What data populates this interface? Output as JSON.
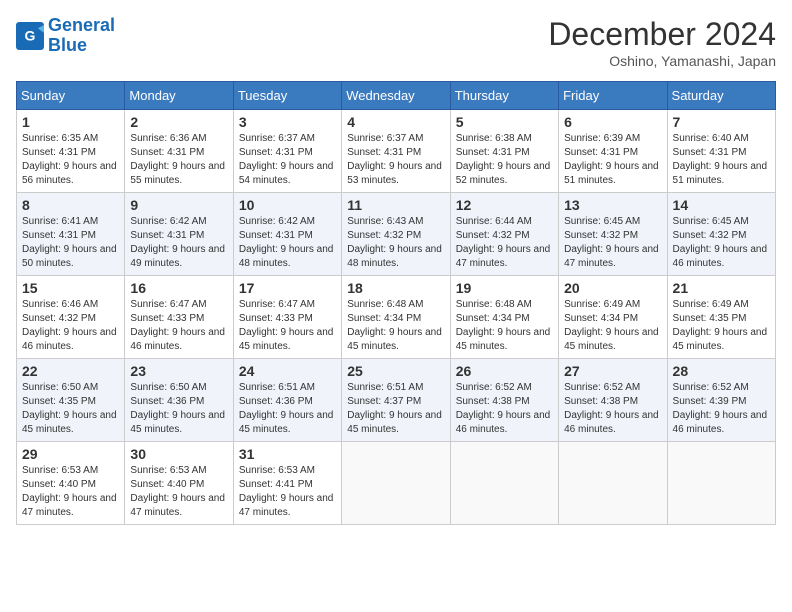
{
  "logo": {
    "line1": "General",
    "line2": "Blue"
  },
  "title": "December 2024",
  "location": "Oshino, Yamanashi, Japan",
  "weekdays": [
    "Sunday",
    "Monday",
    "Tuesday",
    "Wednesday",
    "Thursday",
    "Friday",
    "Saturday"
  ],
  "weeks": [
    [
      {
        "day": "1",
        "sunrise": "6:35 AM",
        "sunset": "4:31 PM",
        "daylight": "9 hours and 56 minutes."
      },
      {
        "day": "2",
        "sunrise": "6:36 AM",
        "sunset": "4:31 PM",
        "daylight": "9 hours and 55 minutes."
      },
      {
        "day": "3",
        "sunrise": "6:37 AM",
        "sunset": "4:31 PM",
        "daylight": "9 hours and 54 minutes."
      },
      {
        "day": "4",
        "sunrise": "6:37 AM",
        "sunset": "4:31 PM",
        "daylight": "9 hours and 53 minutes."
      },
      {
        "day": "5",
        "sunrise": "6:38 AM",
        "sunset": "4:31 PM",
        "daylight": "9 hours and 52 minutes."
      },
      {
        "day": "6",
        "sunrise": "6:39 AM",
        "sunset": "4:31 PM",
        "daylight": "9 hours and 51 minutes."
      },
      {
        "day": "7",
        "sunrise": "6:40 AM",
        "sunset": "4:31 PM",
        "daylight": "9 hours and 51 minutes."
      }
    ],
    [
      {
        "day": "8",
        "sunrise": "6:41 AM",
        "sunset": "4:31 PM",
        "daylight": "9 hours and 50 minutes."
      },
      {
        "day": "9",
        "sunrise": "6:42 AM",
        "sunset": "4:31 PM",
        "daylight": "9 hours and 49 minutes."
      },
      {
        "day": "10",
        "sunrise": "6:42 AM",
        "sunset": "4:31 PM",
        "daylight": "9 hours and 48 minutes."
      },
      {
        "day": "11",
        "sunrise": "6:43 AM",
        "sunset": "4:32 PM",
        "daylight": "9 hours and 48 minutes."
      },
      {
        "day": "12",
        "sunrise": "6:44 AM",
        "sunset": "4:32 PM",
        "daylight": "9 hours and 47 minutes."
      },
      {
        "day": "13",
        "sunrise": "6:45 AM",
        "sunset": "4:32 PM",
        "daylight": "9 hours and 47 minutes."
      },
      {
        "day": "14",
        "sunrise": "6:45 AM",
        "sunset": "4:32 PM",
        "daylight": "9 hours and 46 minutes."
      }
    ],
    [
      {
        "day": "15",
        "sunrise": "6:46 AM",
        "sunset": "4:32 PM",
        "daylight": "9 hours and 46 minutes."
      },
      {
        "day": "16",
        "sunrise": "6:47 AM",
        "sunset": "4:33 PM",
        "daylight": "9 hours and 46 minutes."
      },
      {
        "day": "17",
        "sunrise": "6:47 AM",
        "sunset": "4:33 PM",
        "daylight": "9 hours and 45 minutes."
      },
      {
        "day": "18",
        "sunrise": "6:48 AM",
        "sunset": "4:34 PM",
        "daylight": "9 hours and 45 minutes."
      },
      {
        "day": "19",
        "sunrise": "6:48 AM",
        "sunset": "4:34 PM",
        "daylight": "9 hours and 45 minutes."
      },
      {
        "day": "20",
        "sunrise": "6:49 AM",
        "sunset": "4:34 PM",
        "daylight": "9 hours and 45 minutes."
      },
      {
        "day": "21",
        "sunrise": "6:49 AM",
        "sunset": "4:35 PM",
        "daylight": "9 hours and 45 minutes."
      }
    ],
    [
      {
        "day": "22",
        "sunrise": "6:50 AM",
        "sunset": "4:35 PM",
        "daylight": "9 hours and 45 minutes."
      },
      {
        "day": "23",
        "sunrise": "6:50 AM",
        "sunset": "4:36 PM",
        "daylight": "9 hours and 45 minutes."
      },
      {
        "day": "24",
        "sunrise": "6:51 AM",
        "sunset": "4:36 PM",
        "daylight": "9 hours and 45 minutes."
      },
      {
        "day": "25",
        "sunrise": "6:51 AM",
        "sunset": "4:37 PM",
        "daylight": "9 hours and 45 minutes."
      },
      {
        "day": "26",
        "sunrise": "6:52 AM",
        "sunset": "4:38 PM",
        "daylight": "9 hours and 46 minutes."
      },
      {
        "day": "27",
        "sunrise": "6:52 AM",
        "sunset": "4:38 PM",
        "daylight": "9 hours and 46 minutes."
      },
      {
        "day": "28",
        "sunrise": "6:52 AM",
        "sunset": "4:39 PM",
        "daylight": "9 hours and 46 minutes."
      }
    ],
    [
      {
        "day": "29",
        "sunrise": "6:53 AM",
        "sunset": "4:40 PM",
        "daylight": "9 hours and 47 minutes."
      },
      {
        "day": "30",
        "sunrise": "6:53 AM",
        "sunset": "4:40 PM",
        "daylight": "9 hours and 47 minutes."
      },
      {
        "day": "31",
        "sunrise": "6:53 AM",
        "sunset": "4:41 PM",
        "daylight": "9 hours and 47 minutes."
      },
      null,
      null,
      null,
      null
    ]
  ]
}
